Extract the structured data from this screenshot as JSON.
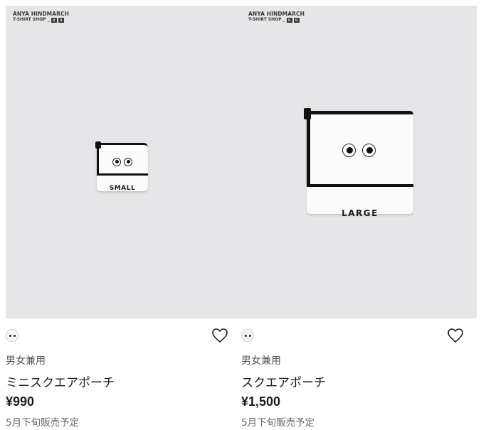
{
  "products": [
    {
      "brand_line1": "ANYA HINDMARCH",
      "brand_line2": "T-SHIRT SHOP",
      "pouch_label": "SMALL",
      "gender": "男女兼用",
      "name": "ミニスクエアポーチ",
      "price": "¥990",
      "availability": "5月下旬販売予定",
      "favorite_icon": "heart-outline-icon",
      "color_swatch": "eyes-white"
    },
    {
      "brand_line1": "ANYA HINDMARCH",
      "brand_line2": "T-SHIRT SHOP",
      "pouch_label": "LARGE",
      "gender": "男女兼用",
      "name": "スクエアポーチ",
      "price": "¥1,500",
      "availability": "5月下旬販売予定",
      "favorite_icon": "heart-outline-icon",
      "color_swatch": "eyes-white"
    }
  ],
  "colors": {
    "image_bg": "#e6e6e8",
    "text_primary": "#1b1b1b",
    "text_secondary": "#666666"
  }
}
